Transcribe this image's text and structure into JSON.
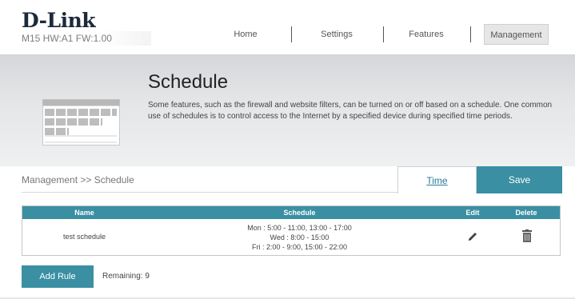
{
  "brand": {
    "logo_text": "D-Link",
    "firmware": "M15 HW:A1 FW:1.00"
  },
  "nav": [
    {
      "label": "Home"
    },
    {
      "label": "Settings"
    },
    {
      "label": "Features"
    },
    {
      "label": "Management",
      "active": true
    }
  ],
  "hero": {
    "title": "Schedule",
    "description": "Some features, such as the firewall and website filters, can be turned on or off based on a schedule. One common use of schedules is to control access to the Internet by a specified device during specified time periods.",
    "icon": "calendar-grid-icon"
  },
  "breadcrumb": "Management >> Schedule",
  "actions": {
    "time_label": "Time",
    "save_label": "Save"
  },
  "table": {
    "columns": [
      "Name",
      "Schedule",
      "Edit",
      "Delete"
    ],
    "rows": [
      {
        "name": "test schedule",
        "schedule": [
          "Mon : 5:00 - 11:00, 13:00 - 17:00",
          "Wed : 8:00 - 15:00",
          "Fri : 2:00 - 9:00, 15:00 - 22:00"
        ],
        "edit_icon": "pencil-icon",
        "delete_icon": "trash-icon"
      }
    ]
  },
  "footer": {
    "add_rule_label": "Add Rule",
    "remaining": "Remaining: 9"
  },
  "colors": {
    "accent": "#3a8fa3",
    "header_bg": "#e3e5e7",
    "link": "#2a7a9c"
  }
}
